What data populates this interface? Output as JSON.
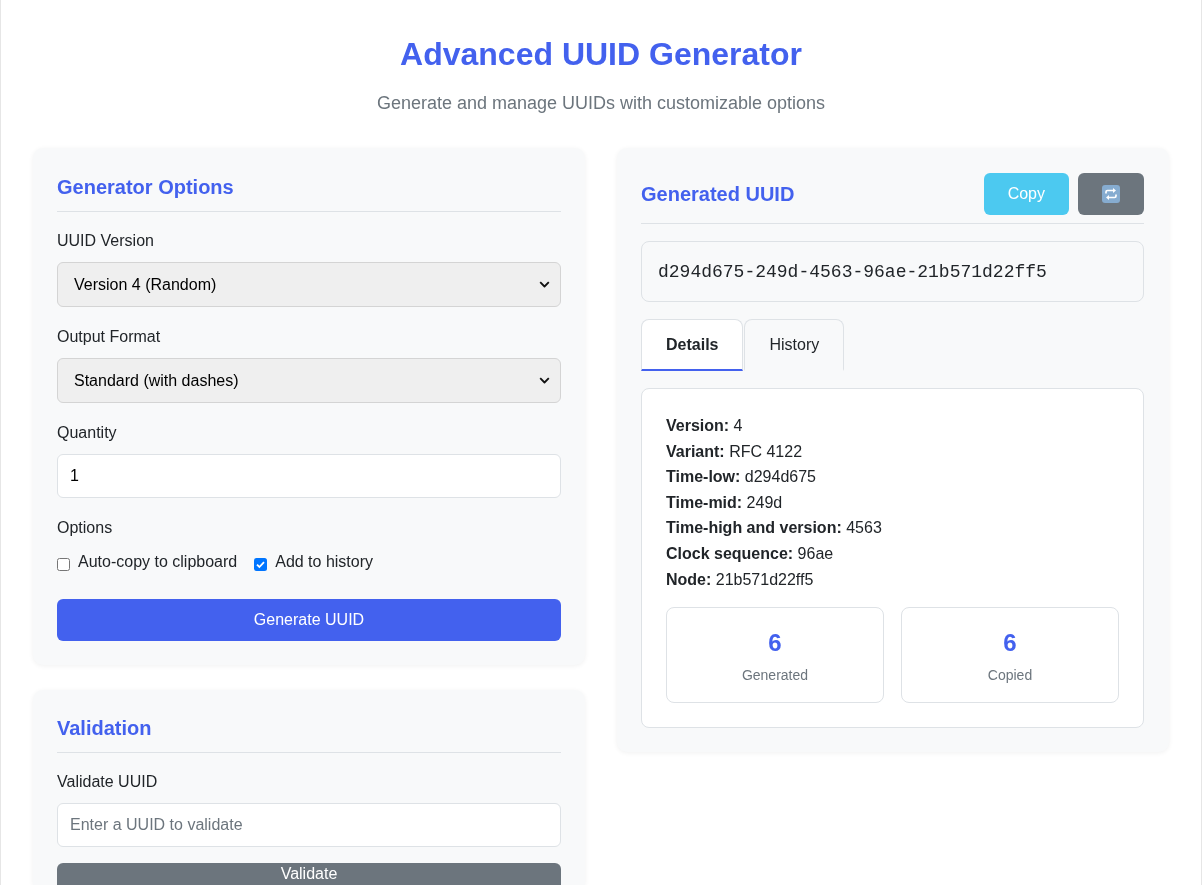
{
  "header": {
    "title": "Advanced UUID Generator",
    "subtitle": "Generate and manage UUIDs with customizable options"
  },
  "generator_options": {
    "title": "Generator Options",
    "fields": [
      {
        "kind": "select",
        "label": "UUID Version",
        "value": "Version 4 (Random)"
      },
      {
        "kind": "select",
        "label": "Output Format",
        "value": "Standard (with dashes)"
      },
      {
        "kind": "input",
        "label": "Quantity",
        "value": "1"
      }
    ],
    "options": {
      "label": "Options",
      "checkboxes": [
        {
          "label": "Auto-copy to clipboard",
          "checked": false
        },
        {
          "label": "Add to history",
          "checked": true
        }
      ]
    },
    "button": "Generate UUID"
  },
  "validation": {
    "title": "Validation",
    "label": "Validate UUID",
    "placeholder": "Enter a UUID to validate",
    "button": "Validate"
  },
  "generated_uuid": {
    "title": "Generated UUID",
    "actions": [
      {
        "kind": "copy",
        "label": "Copy"
      },
      {
        "kind": "refresh"
      }
    ],
    "uuid": "d294d675-249d-4563-96ae-21b571d22ff5",
    "tabs": [
      {
        "label": "Details",
        "selected": true
      },
      {
        "label": "History",
        "selected": false
      }
    ],
    "details": [
      "**Version:** 4",
      "**Variant:** RFC 4122",
      "**Time-low:** d294d675",
      "**Time-mid:** 249d",
      "**Time-high and version:** 4563",
      "**Clock sequence:** 96ae",
      "**Node:** 21b571d22ff5"
    ],
    "stats": [
      {
        "value": "6",
        "label": "Generated"
      },
      {
        "value": "6",
        "label": "Copied"
      }
    ]
  }
}
